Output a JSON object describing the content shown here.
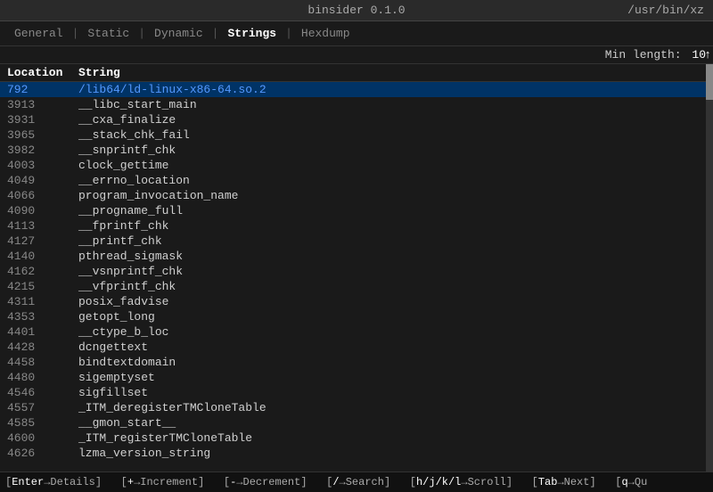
{
  "titlebar": {
    "title": "binsider 0.1.0",
    "path": "/usr/bin/xz"
  },
  "nav": {
    "items": [
      {
        "id": "general",
        "label": "General",
        "active": false
      },
      {
        "id": "static",
        "label": "Static",
        "active": false
      },
      {
        "id": "dynamic",
        "label": "Dynamic",
        "active": false
      },
      {
        "id": "strings",
        "label": "Strings",
        "active": true
      },
      {
        "id": "hexdump",
        "label": "Hexdump",
        "active": false
      }
    ],
    "separators": [
      "|",
      "|",
      "|",
      "|"
    ]
  },
  "toolbar": {
    "min_length_label": "Min length:",
    "min_length_value": "10",
    "scroll_up_icon": "↑"
  },
  "columns": {
    "location": "Location",
    "string": "String"
  },
  "rows": [
    {
      "loc": "792",
      "str": "/lib64/ld-linux-x86-64.so.2",
      "highlighted": true
    },
    {
      "loc": "3913",
      "str": "__libc_start_main",
      "highlighted": false
    },
    {
      "loc": "3931",
      "str": "__cxa_finalize",
      "highlighted": false
    },
    {
      "loc": "3965",
      "str": "__stack_chk_fail",
      "highlighted": false
    },
    {
      "loc": "3982",
      "str": "__snprintf_chk",
      "highlighted": false
    },
    {
      "loc": "4003",
      "str": "clock_gettime",
      "highlighted": false
    },
    {
      "loc": "4049",
      "str": "__errno_location",
      "highlighted": false
    },
    {
      "loc": "4066",
      "str": "program_invocation_name",
      "highlighted": false
    },
    {
      "loc": "4090",
      "str": "__progname_full",
      "highlighted": false
    },
    {
      "loc": "4113",
      "str": "__fprintf_chk",
      "highlighted": false
    },
    {
      "loc": "4127",
      "str": "__printf_chk",
      "highlighted": false
    },
    {
      "loc": "4140",
      "str": "pthread_sigmask",
      "highlighted": false
    },
    {
      "loc": "4162",
      "str": "__vsnprintf_chk",
      "highlighted": false
    },
    {
      "loc": "4215",
      "str": "__vfprintf_chk",
      "highlighted": false
    },
    {
      "loc": "4311",
      "str": "posix_fadvise",
      "highlighted": false
    },
    {
      "loc": "4353",
      "str": "getopt_long",
      "highlighted": false
    },
    {
      "loc": "4401",
      "str": "__ctype_b_loc",
      "highlighted": false
    },
    {
      "loc": "4428",
      "str": "dcngettext",
      "highlighted": false
    },
    {
      "loc": "4458",
      "str": "bindtextdomain",
      "highlighted": false
    },
    {
      "loc": "4480",
      "str": "sigemptyset",
      "highlighted": false
    },
    {
      "loc": "4546",
      "str": "sigfillset",
      "highlighted": false
    },
    {
      "loc": "4557",
      "str": "_ITM_deregisterTMCloneTable",
      "highlighted": false
    },
    {
      "loc": "4585",
      "str": "__gmon_start__",
      "highlighted": false
    },
    {
      "loc": "4600",
      "str": "_ITM_registerTMCloneTable",
      "highlighted": false
    },
    {
      "loc": "4626",
      "str": "lzma_version_string",
      "highlighted": false
    }
  ],
  "statusbar": {
    "items": [
      {
        "key": "Enter",
        "arrow": "→",
        "action": "Details"
      },
      {
        "key": "[+",
        "arrow": "→",
        "action": "Increment]"
      },
      {
        "key": "[-→",
        "arrow": "",
        "action": "Decrement]"
      },
      {
        "key": "[/→",
        "arrow": "",
        "action": "Search]"
      },
      {
        "key": "[h/j/k/l→",
        "arrow": "",
        "action": "Scroll]"
      },
      {
        "key": "[Tab→",
        "arrow": "",
        "action": "Next]"
      },
      {
        "key": "[q→",
        "arrow": "",
        "action": "Qu"
      }
    ],
    "full_text": "[Enter→Details]  [+→Increment]  [-→Decrement]  [/→Search]  [h/j/k/l→Scroll]  [Tab→Next]  [q→Qu"
  }
}
